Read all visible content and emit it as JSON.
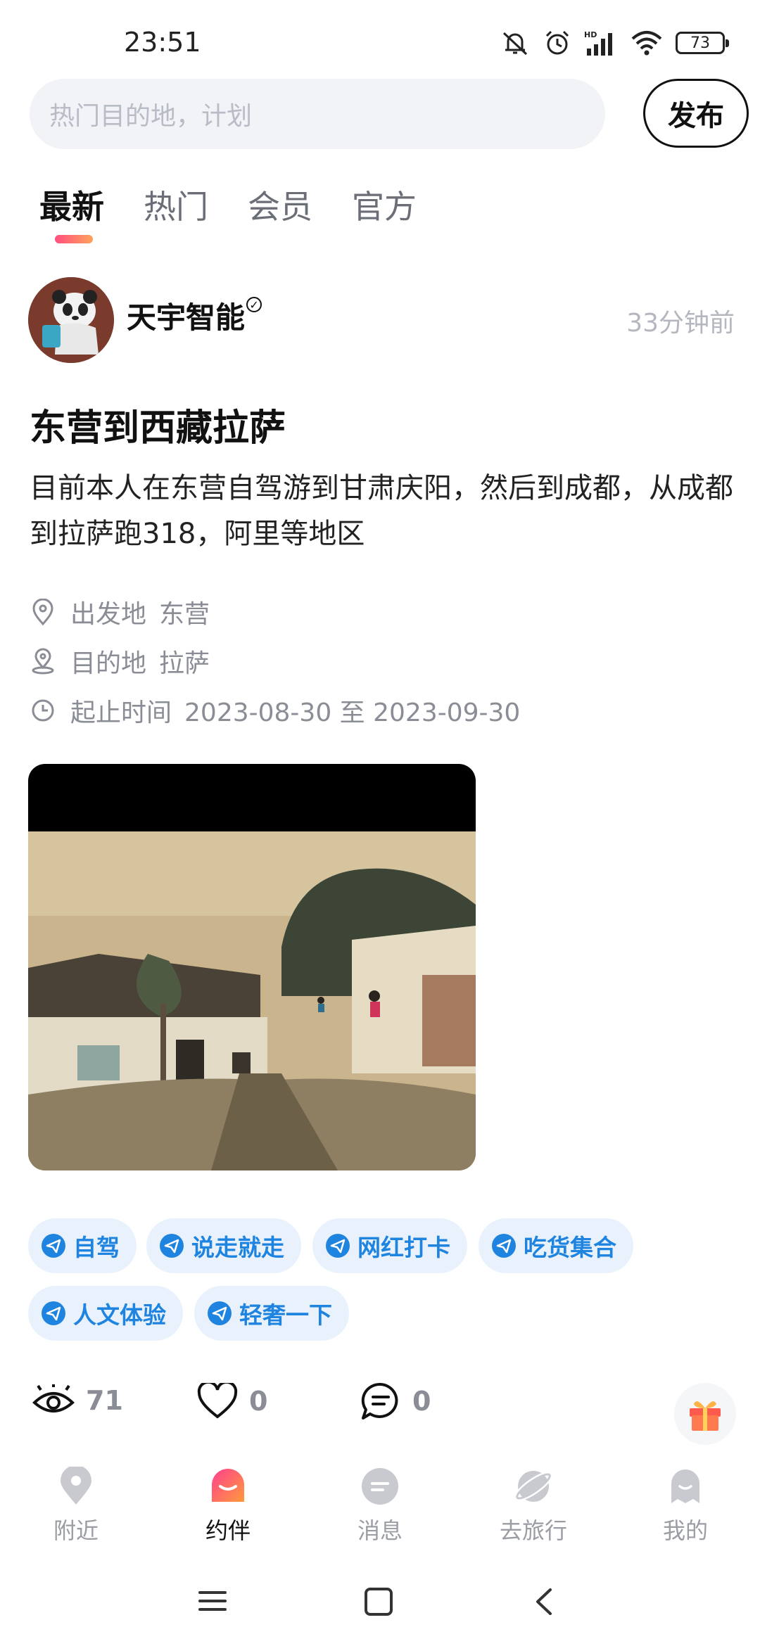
{
  "status_bar": {
    "time": "23:51",
    "battery": "73"
  },
  "search": {
    "placeholder": "热门目的地，计划"
  },
  "publish_label": "发布",
  "tabs": [
    {
      "label": "最新"
    },
    {
      "label": "热门"
    },
    {
      "label": "会员"
    },
    {
      "label": "官方"
    }
  ],
  "post": {
    "author": "天宇智能",
    "time_ago": "33分钟前",
    "title": "东营到西藏拉萨",
    "description": "目前本人在东营自驾游到甘肃庆阳，然后到成都，从成都到拉萨跑318，阿里等地区",
    "departure_label": "出发地",
    "departure": "东营",
    "destination_label": "目的地",
    "destination": "拉萨",
    "period_label": "起止时间",
    "period": "2023-08-30 至 2023-09-30",
    "tags": [
      "自驾",
      "说走就走",
      "网红打卡",
      "吃货集合",
      "人文体验",
      "轻奢一下"
    ],
    "views": "71",
    "likes": "0",
    "comments": "0"
  },
  "bottom_nav": [
    {
      "label": "附近"
    },
    {
      "label": "约伴"
    },
    {
      "label": "消息"
    },
    {
      "label": "去旅行"
    },
    {
      "label": "我的"
    }
  ],
  "colors": {
    "accent_blue": "#1f84e0",
    "tag_bg": "#e9f2fc",
    "indicator_start": "#ff4f7f",
    "indicator_end": "#ffa25a"
  }
}
